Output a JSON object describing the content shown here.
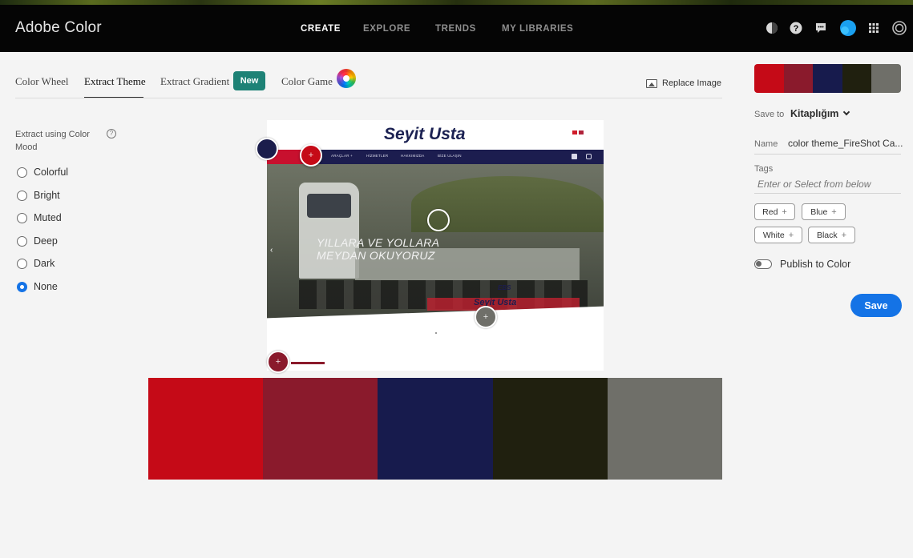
{
  "header": {
    "brand": "Adobe Color",
    "nav": [
      "CREATE",
      "EXPLORE",
      "TRENDS",
      "MY LIBRARIES"
    ],
    "active_nav": "CREATE",
    "icons": [
      "color-mode-icon",
      "help-icon",
      "chat-icon",
      "user-avatar-icon",
      "apps-grid-icon",
      "creative-cloud-icon"
    ]
  },
  "tabs": {
    "color_wheel": "Color Wheel",
    "extract_theme": "Extract Theme",
    "extract_gradient": "Extract Gradient",
    "new_badge": "New",
    "color_game": "Color Game",
    "active": "Extract Theme"
  },
  "replace_image": "Replace Image",
  "mood": {
    "label": "Extract using Color Mood",
    "help": "?",
    "options": [
      "Colorful",
      "Bright",
      "Muted",
      "Deep",
      "Dark",
      "None"
    ],
    "selected": "None"
  },
  "preview": {
    "logo": "Seyit Usta",
    "nav_items": [
      "ARAÇLAR +",
      "HİZMETLER",
      "HAKKIMIZDA",
      "BİZE ULAŞIN"
    ],
    "tagline_line1": "YILLARA VE YOLLARA",
    "tagline_line2": "MEYDAN OKUYORUZ",
    "truck_sign": "Seyit Usta",
    "truck_brand": "EBS",
    "prev_arrow": "‹"
  },
  "theme": {
    "colors": [
      "#c50a17",
      "#8a1a2c",
      "#171b4d",
      "#20200f",
      "#6f6f69"
    ]
  },
  "save_panel": {
    "save_to_label": "Save to",
    "library": "Kitaplığım",
    "name_label": "Name",
    "name_value": "color theme_FireShot Ca...",
    "tags_label": "Tags",
    "tags_placeholder": "Enter or Select from below",
    "tags": [
      "Red",
      "Blue",
      "White",
      "Black"
    ],
    "publish_label": "Publish to Color",
    "save_button": "Save"
  }
}
